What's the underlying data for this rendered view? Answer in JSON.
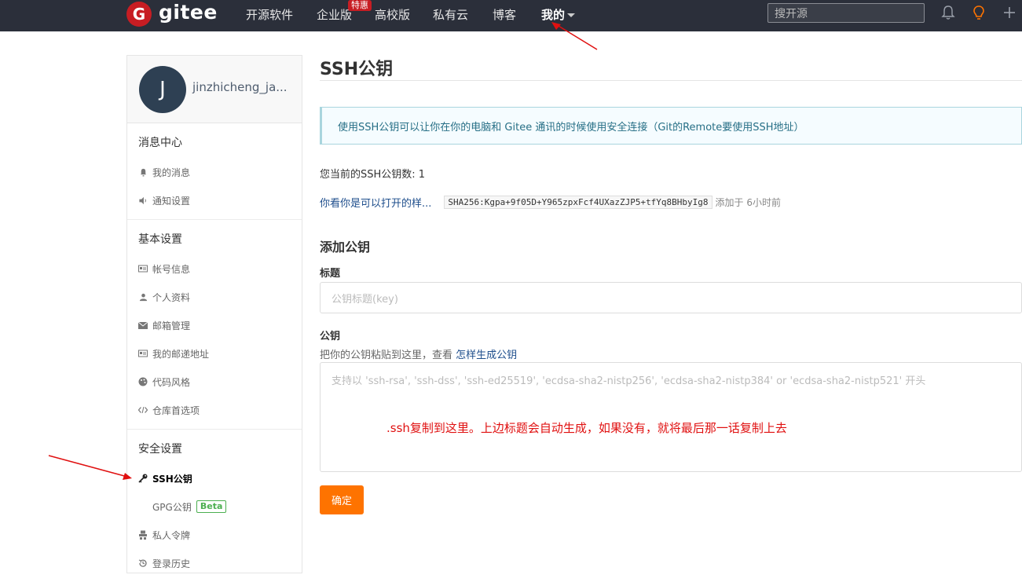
{
  "nav": {
    "logo_letter": "G",
    "logo_text": "gitee",
    "items": [
      "开源软件",
      "企业版",
      "高校版",
      "私有云",
      "博客",
      "我的"
    ],
    "hot_badge": "特惠",
    "search_placeholder": "搜开源"
  },
  "sidebar": {
    "avatar_letter": "J",
    "username": "jinzhicheng_ja...",
    "sections": [
      {
        "title": "消息中心",
        "items": [
          "我的消息",
          "通知设置"
        ]
      },
      {
        "title": "基本设置",
        "items": [
          "帐号信息",
          "个人资料",
          "邮箱管理",
          "我的邮递地址",
          "代码风格",
          "仓库首选项"
        ]
      },
      {
        "title": "安全设置",
        "items": [
          "SSH公钥",
          "GPG公钥",
          "私人令牌",
          "登录历史"
        ]
      }
    ],
    "beta_label": "Beta"
  },
  "main": {
    "title": "SSH公钥",
    "info": "使用SSH公钥可以让你在你的电脑和 Gitee 通讯的时候使用安全连接（Git的Remote要使用SSH地址）",
    "count_text": "您当前的SSH公钥数: 1",
    "key": {
      "name": "你看你是可以打开的样...",
      "fingerprint": "SHA256:Kgpa+9f05D+Y965zpxFcf4UXazZJP5+tfYq8BHbyIg8",
      "added": "添加于 6小时前"
    },
    "add_heading": "添加公钥",
    "title_label": "标题",
    "title_placeholder": "公钥标题(key)",
    "key_label": "公钥",
    "key_hint": "把你的公钥粘贴到这里，查看 ",
    "key_hint_link": "怎样生成公钥",
    "key_placeholder": "支持以 'ssh-rsa', 'ssh-dss', 'ssh-ed25519', 'ecdsa-sha2-nistp256', 'ecdsa-sha2-nistp384' or 'ecdsa-sha2-nistp521' 开头",
    "annotation": ".ssh复制到这里。上边标题会自动生成，如果没有，就将最后那一话复制上去",
    "confirm_label": "确定"
  }
}
